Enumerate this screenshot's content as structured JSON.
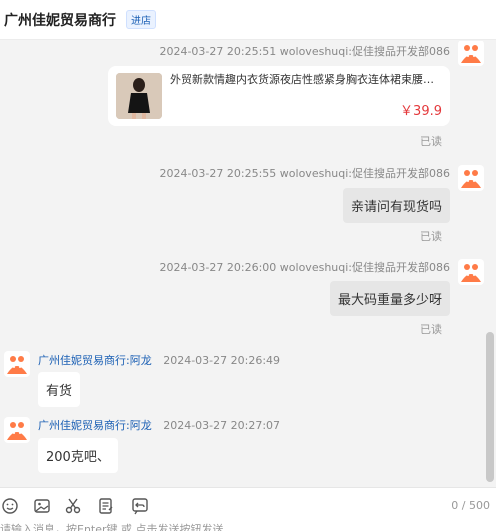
{
  "header": {
    "shop_name": "广州佳妮贸易商行",
    "enter_tag": "进店"
  },
  "messages": [
    {
      "meta": "2024-03-27 20:25:51   woloveshuqi:促佳搜品开发部086",
      "product": {
        "title": "外贸新款情趣内衣货源夜店性感紧身胸衣连体裙束腰免…",
        "price": "￥39.9"
      },
      "read": "已读"
    },
    {
      "meta": "2024-03-27 20:25:55   woloveshuqi:促佳搜品开发部086",
      "text": "亲请问有现货吗",
      "read": "已读"
    },
    {
      "meta": "2024-03-27 20:26:00   woloveshuqi:促佳搜品开发部086",
      "text": "最大码重量多少呀",
      "read": "已读"
    },
    {
      "name": "广州佳妮贸易商行:阿龙",
      "time": "2024-03-27 20:26:49",
      "text": "有货"
    },
    {
      "name": "广州佳妮贸易商行:阿龙",
      "time": "2024-03-27 20:27:07",
      "text": "200克吧、"
    }
  ],
  "toolbar": {
    "icons": [
      "smile-icon",
      "image-icon",
      "scissors-icon",
      "document-icon",
      "undo-icon"
    ],
    "char_count": "0 / 500"
  },
  "input": {
    "placeholder": "请输入消息，按Enter键 或 点击发送按钮发送"
  },
  "colors": {
    "price": "#e4393c",
    "link": "#1a5fb4",
    "avatar": "#ff7b47"
  }
}
